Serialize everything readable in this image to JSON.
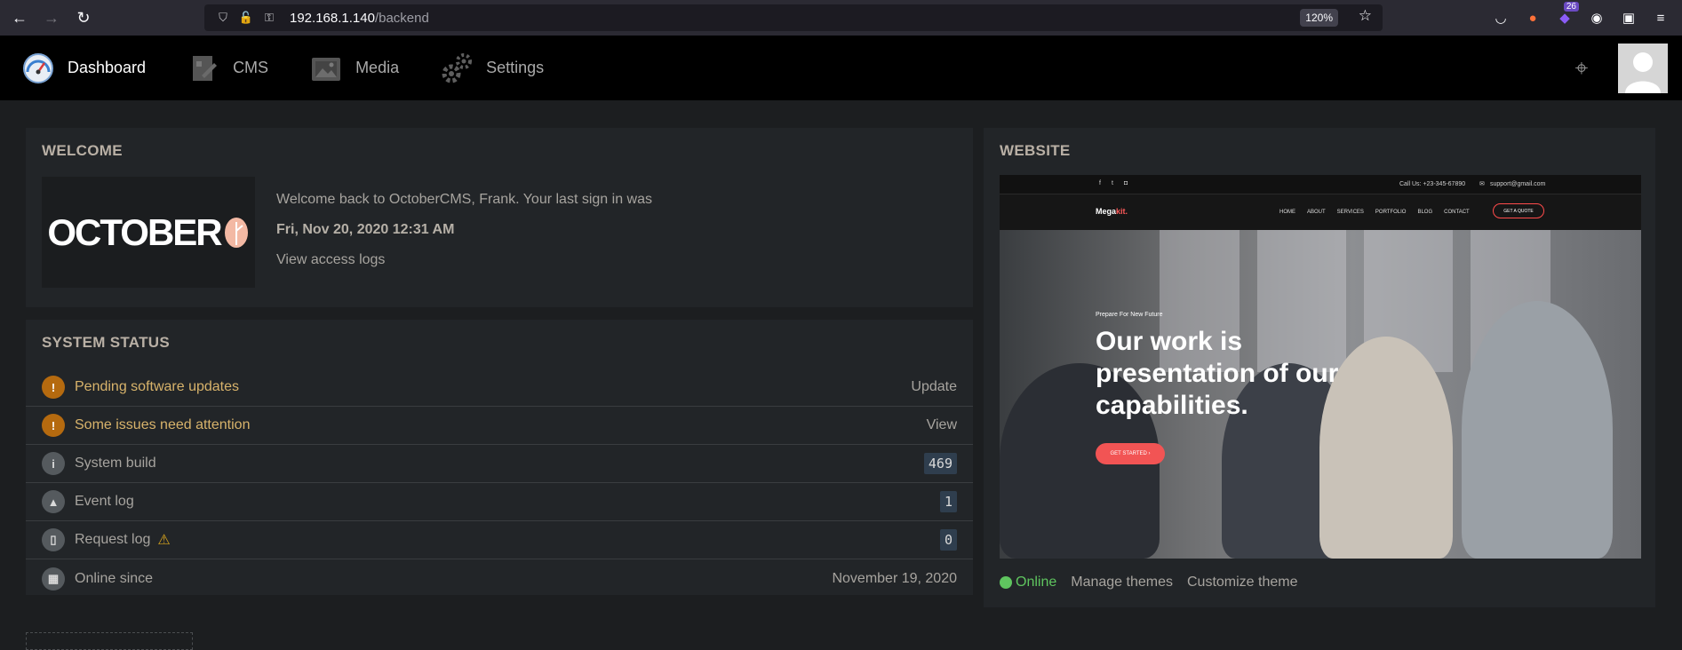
{
  "browser": {
    "url_host": "192.168.1.140",
    "url_path": "/backend",
    "zoom": "120%",
    "extension_badge": "26"
  },
  "nav": {
    "items": [
      {
        "label": "Dashboard",
        "icon": "dashboard-gauge-icon"
      },
      {
        "label": "CMS",
        "icon": "cms-icon"
      },
      {
        "label": "Media",
        "icon": "media-icon"
      },
      {
        "label": "Settings",
        "icon": "settings-gear-icon"
      }
    ]
  },
  "welcome": {
    "title": "WELCOME",
    "logo_text": "OCTOBER",
    "message": "Welcome back to OctoberCMS, Frank. Your last sign in was",
    "last_login": "Fri, Nov 20, 2020 12:31 AM",
    "link": "View access logs"
  },
  "status": {
    "title": "SYSTEM STATUS",
    "rows": [
      {
        "label": "Pending software updates",
        "value": "Update",
        "type": "warn"
      },
      {
        "label": "Some issues need attention",
        "value": "View",
        "type": "warn"
      },
      {
        "label": "System build",
        "value": "469",
        "type": "code"
      },
      {
        "label": "Event log",
        "value": "1",
        "type": "code"
      },
      {
        "label": "Request log",
        "value": "0",
        "type": "code"
      },
      {
        "label": "Online since",
        "value": "November 19, 2020",
        "type": "text"
      }
    ]
  },
  "website": {
    "title": "WEBSITE",
    "preview": {
      "call": "Call Us: +23-345-67890",
      "email": "support@gmail.com",
      "brand_main": "Mega",
      "brand_accent": "kit.",
      "menu": [
        "HOME",
        "ABOUT",
        "SERVICES",
        "PORTFOLIO",
        "BLOG",
        "CONTACT"
      ],
      "quote_button": "GET A QUOTE",
      "kicker": "Prepare For New Future",
      "headline": "Our work is presentation of our capabilities.",
      "cta": "GET STARTED ›"
    },
    "status": "Online",
    "links": [
      "Manage themes",
      "Customize theme"
    ]
  },
  "colors": {
    "warning": "#b56a0f",
    "online": "#5fc55f",
    "code_bg": "#2f3e4e",
    "accent_red": "#f25454"
  }
}
